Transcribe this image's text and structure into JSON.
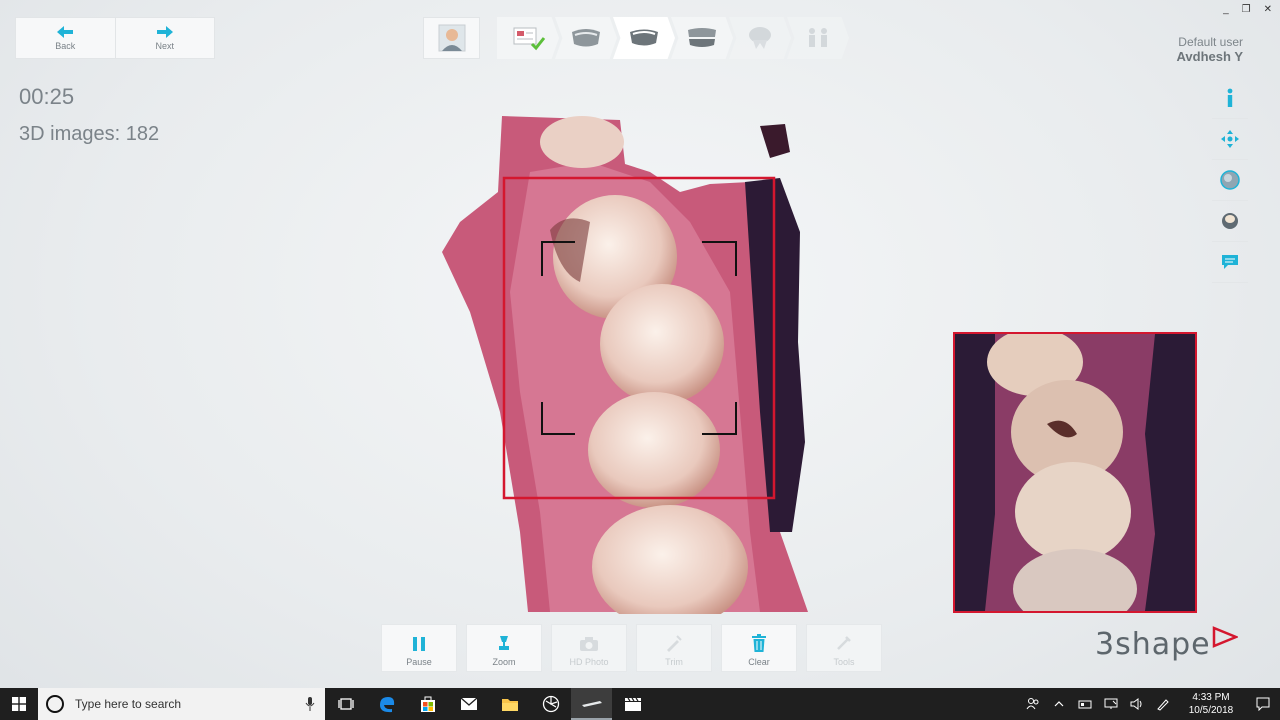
{
  "window": {
    "controls": [
      "_",
      "❐",
      "✕"
    ]
  },
  "nav": {
    "back_label": "Back",
    "next_label": "Next"
  },
  "status": {
    "timer": "00:25",
    "images_count": "3D images: 182"
  },
  "user": {
    "role": "Default user",
    "name": "Avdhesh Y"
  },
  "toolbar": {
    "pause_label": "Pause",
    "zoom_label": "Zoom",
    "hdphoto_label": "HD Photo",
    "trim_label": "Trim",
    "clear_label": "Clear",
    "tools_label": "Tools"
  },
  "brand": {
    "logo_text": "3shape"
  },
  "taskbar": {
    "search_placeholder": "Type here to search",
    "time": "4:33 PM",
    "date": "10/5/2018"
  },
  "colors": {
    "accent": "#1fb3d7",
    "frame_red": "#d4172f",
    "taskbar": "#1f1f1f"
  }
}
